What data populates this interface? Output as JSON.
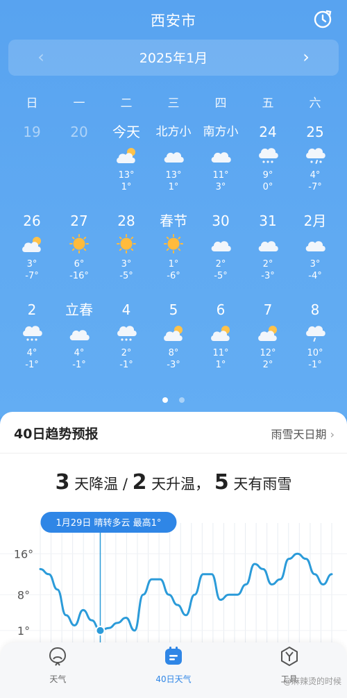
{
  "header": {
    "city": "西安市",
    "month": "2025年1月",
    "prev": "‹",
    "next": "›"
  },
  "weekdays": [
    "日",
    "一",
    "二",
    "三",
    "四",
    "五",
    "六"
  ],
  "weeks": [
    [
      {
        "label": "19",
        "faded": true,
        "icon": "",
        "hi": "",
        "lo": ""
      },
      {
        "label": "20",
        "faded": true,
        "icon": "",
        "hi": "",
        "lo": ""
      },
      {
        "label": "今天",
        "icon": "partly-cloudy-icon",
        "hi": "13°",
        "lo": "1°"
      },
      {
        "label": "北方小",
        "icon": "cloudy-icon",
        "hi": "13°",
        "lo": "1°"
      },
      {
        "label": "南方小",
        "icon": "cloudy-icon",
        "hi": "11°",
        "lo": "3°"
      },
      {
        "label": "24",
        "icon": "snow-icon",
        "hi": "9°",
        "lo": "0°"
      },
      {
        "label": "25",
        "icon": "sleet-icon",
        "hi": "4°",
        "lo": "-7°"
      }
    ],
    [
      {
        "label": "26",
        "icon": "partly-cloudy-icon",
        "hi": "3°",
        "lo": "-7°"
      },
      {
        "label": "27",
        "icon": "sunny-icon",
        "hi": "6°",
        "lo": "-16°"
      },
      {
        "label": "28",
        "icon": "sunny-icon",
        "hi": "3°",
        "lo": "-5°"
      },
      {
        "label": "春节",
        "icon": "sunny-icon",
        "hi": "1°",
        "lo": "-6°"
      },
      {
        "label": "30",
        "icon": "cloudy-icon",
        "hi": "2°",
        "lo": "-5°"
      },
      {
        "label": "31",
        "icon": "cloudy-icon",
        "hi": "2°",
        "lo": "-3°"
      },
      {
        "label": "2月",
        "icon": "cloudy-icon",
        "hi": "3°",
        "lo": "-4°"
      }
    ],
    [
      {
        "label": "2",
        "icon": "snow-icon",
        "hi": "4°",
        "lo": "-1°"
      },
      {
        "label": "立春",
        "icon": "cloudy-icon",
        "hi": "4°",
        "lo": "-1°"
      },
      {
        "label": "4",
        "icon": "snow-icon",
        "hi": "2°",
        "lo": "-1°"
      },
      {
        "label": "5",
        "icon": "partly-cloudy-icon",
        "hi": "8°",
        "lo": "-3°"
      },
      {
        "label": "6",
        "icon": "partly-cloudy-icon",
        "hi": "11°",
        "lo": "1°"
      },
      {
        "label": "7",
        "icon": "partly-cloudy-icon",
        "hi": "12°",
        "lo": "2°"
      },
      {
        "label": "8",
        "icon": "rain-icon",
        "hi": "10°",
        "lo": "-1°"
      }
    ]
  ],
  "trend": {
    "title": "40日趋势预报",
    "link": "雨雪天日期",
    "summary": {
      "n1": "3",
      "t1": "天降温",
      "sep": "/",
      "n2": "2",
      "t2": "天升温，",
      "n3": "5",
      "t3": "天有雨雪"
    },
    "tooltip": "1月29日  晴转多云  最高1°"
  },
  "chart_data": {
    "type": "line",
    "title": "",
    "xlabel": "",
    "ylabel": "",
    "yticks": [
      "16°",
      "8°",
      "1°"
    ],
    "ytick_values": [
      16,
      8,
      1
    ],
    "ylim": [
      -2,
      22
    ],
    "grid": true,
    "highlight_index": 7,
    "series": [
      {
        "values": [
          13,
          12,
          9,
          4,
          2,
          5,
          3,
          1,
          1.5,
          2.5,
          3.5,
          1,
          8,
          11,
          11,
          8,
          6,
          4,
          8,
          12,
          12,
          7,
          8,
          8,
          10,
          14,
          13,
          10,
          11,
          15,
          16,
          15,
          12,
          10,
          12
        ]
      }
    ]
  },
  "tabs": [
    {
      "label": "天气",
      "icon": "weather-tab-icon",
      "active": false
    },
    {
      "label": "40日天气",
      "icon": "calendar-tab-icon",
      "active": true
    },
    {
      "label": "工具",
      "icon": "tools-tab-icon",
      "active": false
    }
  ],
  "watermark": "@麻辣烫的时候",
  "colors": {
    "sky": "#5ba6f0",
    "accent": "#2f86e6",
    "line": "#2b9bd9"
  }
}
